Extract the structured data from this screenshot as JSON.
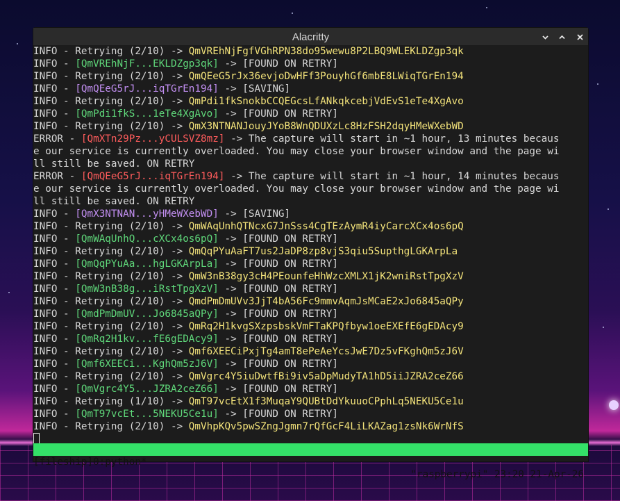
{
  "window": {
    "title": "Alacritty"
  },
  "lines": [
    [
      {
        "t": "INFO - Retrying (2/10) -> ",
        "c": ""
      },
      {
        "t": "QmVREhNjFgfVGhRPN38do95wewu8P2LBQ9WLEKLDZgp3qk",
        "c": "y"
      }
    ],
    [
      {
        "t": "INFO - ",
        "c": ""
      },
      {
        "t": "[QmVREhNjF...EKLDZgp3qk]",
        "c": "g"
      },
      {
        "t": " -> [FOUND ON RETRY]",
        "c": ""
      }
    ],
    [
      {
        "t": "INFO - Retrying (2/10) -> ",
        "c": ""
      },
      {
        "t": "QmQEeG5rJx36evjoDwHFf3PouyhGf6mbE8LWiqTGrEn194",
        "c": "y"
      }
    ],
    [
      {
        "t": "INFO - ",
        "c": ""
      },
      {
        "t": "[QmQEeG5rJ...iqTGrEn194]",
        "c": "p"
      },
      {
        "t": " -> [SAVING]",
        "c": ""
      }
    ],
    [
      {
        "t": "INFO - Retrying (2/10) -> ",
        "c": ""
      },
      {
        "t": "QmPdi1fkSnokbCCQEGcsLfANkqkcebjVdEvS1eTe4XgAvo",
        "c": "y"
      }
    ],
    [
      {
        "t": "INFO - ",
        "c": ""
      },
      {
        "t": "[QmPdi1fkS...1eTe4XgAvo]",
        "c": "g"
      },
      {
        "t": " -> [FOUND ON RETRY]",
        "c": ""
      }
    ],
    [
      {
        "t": "INFO - Retrying (2/10) -> ",
        "c": ""
      },
      {
        "t": "QmX3NTNANJouyJYoB8WnQDUXzLc8HzFSH2dqyHMeWXebWD",
        "c": "y"
      }
    ],
    [
      {
        "t": "ERROR - ",
        "c": ""
      },
      {
        "t": "[QmXTn29Pz...yCULSVZ8mz]",
        "c": "r"
      },
      {
        "t": " -> The capture will start in ~1 hour, 13 minutes becaus",
        "c": ""
      }
    ],
    [
      {
        "t": "e our service is currently overloaded. You may close your browser window and the page wi",
        "c": ""
      }
    ],
    [
      {
        "t": "ll still be saved. ON RETRY",
        "c": ""
      }
    ],
    [
      {
        "t": "ERROR - ",
        "c": ""
      },
      {
        "t": "[QmQEeG5rJ...iqTGrEn194]",
        "c": "r"
      },
      {
        "t": " -> The capture will start in ~1 hour, 14 minutes becaus",
        "c": ""
      }
    ],
    [
      {
        "t": "e our service is currently overloaded. You may close your browser window and the page wi",
        "c": ""
      }
    ],
    [
      {
        "t": "ll still be saved. ON RETRY",
        "c": ""
      }
    ],
    [
      {
        "t": "INFO - ",
        "c": ""
      },
      {
        "t": "[QmX3NTNAN...yHMeWXebWD]",
        "c": "p"
      },
      {
        "t": " -> [SAVING]",
        "c": ""
      }
    ],
    [
      {
        "t": "INFO - Retrying (2/10) -> ",
        "c": ""
      },
      {
        "t": "QmWAqUnhQTNcxG7JnSss4CgTEzAymR4iyCarcXCx4os6pQ",
        "c": "y"
      }
    ],
    [
      {
        "t": "INFO - ",
        "c": ""
      },
      {
        "t": "[QmWAqUnhQ...cXCx4os6pQ]",
        "c": "g"
      },
      {
        "t": " -> [FOUND ON RETRY]",
        "c": ""
      }
    ],
    [
      {
        "t": "INFO - Retrying (2/10) -> ",
        "c": ""
      },
      {
        "t": "QmQqPYuAaFT7us2JaDP8zp8vjS3qiu5SupthgLGKArpLa",
        "c": "y"
      }
    ],
    [
      {
        "t": "INFO - ",
        "c": ""
      },
      {
        "t": "[QmQqPYuAa...hgLGKArpLa]",
        "c": "g"
      },
      {
        "t": " -> [FOUND ON RETRY]",
        "c": ""
      }
    ],
    [
      {
        "t": "INFO - Retrying (2/10) -> ",
        "c": ""
      },
      {
        "t": "QmW3nB38gy3cH4PEounfeHhWzcXMLX1jK2wniRstTpgXzV",
        "c": "y"
      }
    ],
    [
      {
        "t": "INFO - ",
        "c": ""
      },
      {
        "t": "[QmW3nB38g...iRstTpgXzV]",
        "c": "g"
      },
      {
        "t": " -> [FOUND ON RETRY]",
        "c": ""
      }
    ],
    [
      {
        "t": "INFO - Retrying (2/10) -> ",
        "c": ""
      },
      {
        "t": "QmdPmDmUVv3JjT4bA56Fc9mmvAqmJsMCaE2xJo6845aQPy",
        "c": "y"
      }
    ],
    [
      {
        "t": "INFO - ",
        "c": ""
      },
      {
        "t": "[QmdPmDmUV...Jo6845aQPy]",
        "c": "g"
      },
      {
        "t": " -> [FOUND ON RETRY]",
        "c": ""
      }
    ],
    [
      {
        "t": "INFO - Retrying (2/10) -> ",
        "c": ""
      },
      {
        "t": "QmRq2H1kvgSXzpsbskVmFTaKPQfbyw1oeEXEfE6gEDAcy9",
        "c": "y"
      }
    ],
    [
      {
        "t": "INFO - ",
        "c": ""
      },
      {
        "t": "[QmRq2H1kv...fE6gEDAcy9]",
        "c": "g"
      },
      {
        "t": " -> [FOUND ON RETRY]",
        "c": ""
      }
    ],
    [
      {
        "t": "INFO - Retrying (2/10) -> ",
        "c": ""
      },
      {
        "t": "Qmf6XEECiPxjTg4amT8ePeAeYcsJwE7Dz5vFKghQm5zJ6V",
        "c": "y"
      }
    ],
    [
      {
        "t": "INFO - ",
        "c": ""
      },
      {
        "t": "[Qmf6XEECi...KghQm5zJ6V]",
        "c": "g"
      },
      {
        "t": " -> [FOUND ON RETRY]",
        "c": ""
      }
    ],
    [
      {
        "t": "INFO - Retrying (2/10) -> ",
        "c": ""
      },
      {
        "t": "QmVgrc4Y5iuDwtfBi9iv5aDpMudyTA1hD5iiJZRA2ceZ66",
        "c": "y"
      }
    ],
    [
      {
        "t": "INFO - ",
        "c": ""
      },
      {
        "t": "[QmVgrc4Y5...JZRA2ceZ66]",
        "c": "g"
      },
      {
        "t": " -> [FOUND ON RETRY]",
        "c": ""
      }
    ],
    [
      {
        "t": "INFO - Retrying (1/10) -> ",
        "c": ""
      },
      {
        "t": "QmT97vcEtX1f3MuqaY9QUBtDdYkuuoCPphLq5NEKU5Ce1u",
        "c": "y"
      }
    ],
    [
      {
        "t": "INFO - ",
        "c": ""
      },
      {
        "t": "[QmT97vcEt...5NEKU5Ce1u]",
        "c": "g"
      },
      {
        "t": " -> [FOUND ON RETRY]",
        "c": ""
      }
    ],
    [
      {
        "t": "INFO - Retrying (2/10) -> ",
        "c": ""
      },
      {
        "t": "QmVhpKQv5pwSZngJgmn7rQfGcF4LiLKAZag1zsNk6WrNfS",
        "c": "y"
      }
    ]
  ],
  "statusbar": {
    "session": "[fileship]0:python*",
    "host_time": "\"raspberrypi\" 23:20 21-Apr-26"
  },
  "colors": {
    "green": "#5fd77a",
    "red": "#ff5c5c",
    "purple": "#c18ef0",
    "yellow": "#f2e27a",
    "status_bg": "#34e068"
  }
}
